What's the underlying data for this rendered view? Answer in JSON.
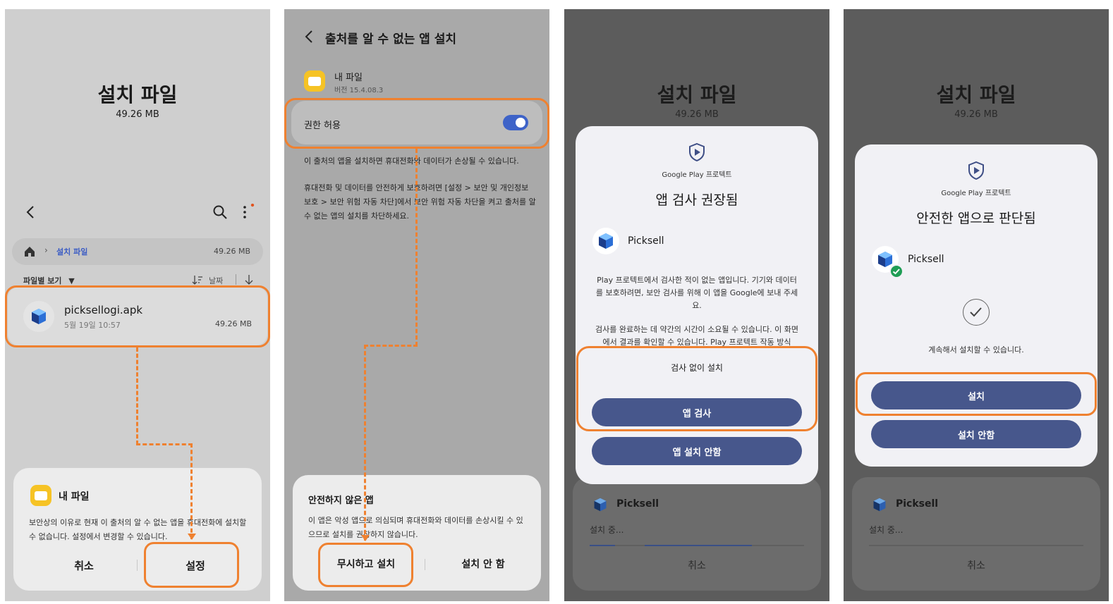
{
  "screen1": {
    "title": "설치 파일",
    "size": "49.26 MB",
    "nav": {
      "back_icon": "chevron-left-icon",
      "search_icon": "search-icon",
      "more_icon": "more-vertical-icon"
    },
    "breadcrumb": {
      "home_icon": "home-icon",
      "folder": "설치 파일",
      "size": "49.26 MB"
    },
    "sort": {
      "view": "파일별 보기",
      "order": "날짜"
    },
    "file": {
      "name": "picksellogi.apk",
      "date": "5월 19일 10:57",
      "size": "49.26 MB"
    },
    "dialog": {
      "app": "내 파일",
      "message": "보안상의 이유로 현재 이 출처의 알 수 없는 앱을 휴대전화에 설치할 수 없습니다. 설정에서 변경할 수 있습니다.",
      "cancel": "취소",
      "settings": "설정"
    }
  },
  "screen2": {
    "header": "출처를 알 수 없는 앱 설치",
    "app_name": "내 파일",
    "app_version": "버전 15.4.08.3",
    "permission_label": "권한 허용",
    "permission_on": true,
    "info1": "이 출처의 앱을 설치하면 휴대전화와 데이터가 손상될 수 있습니다.",
    "info2": "휴대전화 및 데이터를 안전하게 보호하려면 [설정 > 보안 및 개인정보 보호 > 보안 위험 자동 차단]에서 보안 위험 자동 차단을 켜고 출처를 알 수 없는 앱의 설치를 차단하세요.",
    "dialog": {
      "title": "안전하지 않은 앱",
      "message": "이 앱은 악성 앱으로 의심되며 휴대전화와 데이터를 손상시킬 수 있으므로 설치를 권장하지 않습니다.",
      "install_anyway": "무시하고 설치",
      "dont_install": "설치 안 함"
    }
  },
  "screen3": {
    "title": "설치 파일",
    "size": "49.26 MB",
    "card": {
      "brand": "Google Play 프로텍트",
      "heading": "앱 검사 권장됨",
      "app": "Picksell",
      "body1": "Play 프로텍트에서 검사한 적이 없는 앱입니다. 기기와 데이터를 보호하려면, 보안 검사를 위해 이 앱을 Google에 보내 주세요.",
      "body2": "검사를 완료하는 데 약간의 시간이 소요될 수 있습니다. 이 화면에서 결과를 확인할 수 있습니다. Play 프로텍트 작동 방식",
      "install_without_scan": "검사 없이 설치",
      "scan_app": "앱 검사",
      "dont_install": "앱 설치 안함"
    },
    "bottom": {
      "app": "Picksell",
      "status": "설치 중...",
      "cancel": "취소"
    }
  },
  "screen4": {
    "title": "설치 파일",
    "size": "49.26 MB",
    "card": {
      "brand": "Google Play 프로텍트",
      "heading": "안전한 앱으로 판단됨",
      "app": "Picksell",
      "message": "계속해서 설치할 수 있습니다.",
      "install": "설치",
      "dont_install": "설치 안함"
    },
    "bottom": {
      "app": "Picksell",
      "status": "설치 중...",
      "cancel": "취소"
    }
  },
  "colors": {
    "highlight": "#ef8130",
    "primary_button": "#47578c",
    "toggle": "#3e63c8",
    "check_badge": "#1f9d55"
  }
}
